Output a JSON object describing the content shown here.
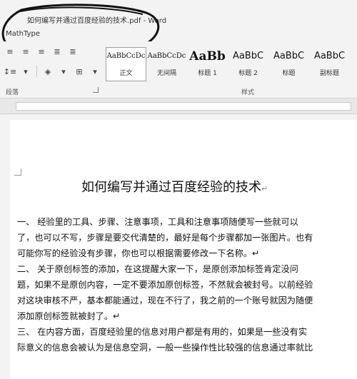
{
  "window": {
    "title": "如何编写并通过百度经验的技术.pdf - Word",
    "tab": "MathType"
  },
  "ribbon": {
    "paragraph_group_label": "段落",
    "styles_group_label": "样式",
    "styles": [
      {
        "preview": "AaBbCcDc",
        "name": "正文"
      },
      {
        "preview": "AaBbCcDc",
        "name": "无间隔"
      },
      {
        "preview": "AaBb",
        "name": "标题 1"
      },
      {
        "preview": "AaBbC",
        "name": "标题 2"
      },
      {
        "preview": "AaBbC",
        "name": "标题"
      },
      {
        "preview": "AaBbC",
        "name": "副标题"
      }
    ]
  },
  "document": {
    "title": "如何编写并通过百度经验的技术",
    "para_mark": "↵",
    "lines": [
      "一、      经验里的工具、步骤、注意事项，工具和注意事项随便写一些就可以",
      "了，也可以不写，步骤是要交代清楚的，最好是每个步骤都加一张图片。也有",
      "可能你写的经验没有步骤，你也可以根据需要修改一下名称。↵",
      "二、      关于原创标签的添加，在这提醒大家一下，是原创添加标签肯定没问",
      "题，如果不是原创内容，一定不要添加原创标签，不然就会被封号。以前经验",
      "对这块审核不严，基本都能通过，现在不行了，我之前的一个账号就因为随便",
      "添加原创标签就被封了。↵",
      "三、      在内容方面，百度经验里的信息对用户都是有用的，如果是一些没有实",
      "际意义的信息会被认为是信息空洞，一般一些操作性比较强的信息通过率就比"
    ]
  }
}
